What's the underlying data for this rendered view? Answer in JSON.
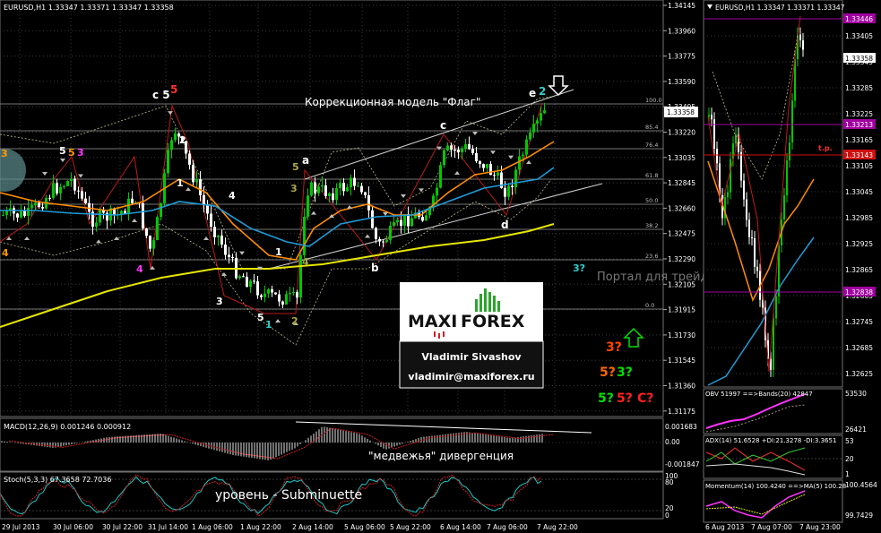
{
  "main_chart": {
    "title": "EURUSD,H1  1.33347 1.33371 1.33347 1.33358",
    "price_ticks": [
      "1.34145",
      "1.33960",
      "1.33775",
      "1.33590",
      "1.33405",
      "1.33220",
      "1.33035",
      "1.32845",
      "1.32660",
      "1.32475",
      "1.32290",
      "1.32105",
      "1.31915",
      "1.31730",
      "1.31545",
      "1.31360",
      "1.31175"
    ],
    "current_price": "1.33358",
    "fib_levels": [
      "100.0",
      "85.4",
      "76.4",
      "61.8",
      "50.0",
      "38.2",
      "23.6",
      "0.0"
    ],
    "time_ticks": [
      "29 Jul 2013",
      "30 Jul 06:00",
      "30 Jul 22:00",
      "31 Jul 14:00",
      "1 Aug 06:00",
      "1 Aug 22:00",
      "2 Aug 14:00",
      "5 Aug 06:00",
      "5 Aug 22:00",
      "6 Aug 14:00",
      "7 Aug 06:00",
      "7 Aug 22:00"
    ],
    "annotation_title": "Коррекционная модель \"Флаг\"",
    "watermark": "Портал для трейдеров - ForTrader.ru",
    "divergence_label": "\"медвежья\" дивергенция",
    "level_label": "уровень - Subminuette",
    "wave_labels": {
      "c5": "c 5",
      "c5_red": "5",
      "w3": "3",
      "w5": "5",
      "w5b": "5",
      "w3b": "3",
      "w4": "4",
      "w1": "1",
      "w4b": "4",
      "w2": "2",
      "w3c": "3",
      "w5c": "5",
      "w1c": "1",
      "w2c": "2",
      "w4c": "4",
      "w1d": "1",
      "w5d": "5",
      "w3d": "3",
      "a": "a",
      "b": "b",
      "c": "c",
      "d": "d",
      "e": "e",
      "e2": "2"
    },
    "projection": {
      "q3cyan": "3?",
      "q3": "3?",
      "q5": "5?",
      "q3g": "3?",
      "q5g": "5?",
      "q5r": "5?",
      "qc": "C?"
    },
    "logo": {
      "maxi": "MAXI",
      "forex": "FOREX",
      "name": "Vladimir Sivashov",
      "email": "vladimir@maxiforex.ru"
    }
  },
  "macd": {
    "title": "MACD(12,26,9) 0.001246 0.000912",
    "ticks": [
      "0.001683",
      "0.00",
      "-0.001847"
    ]
  },
  "stoch": {
    "title": "Stoch(5,3,3) 67.3658 72.7036",
    "ticks": [
      "100",
      "80",
      "20",
      "0"
    ]
  },
  "right_chart": {
    "title": "EURUSD,H1  1.33347 1.33371 1.33347",
    "price_ticks": [
      "1.33405",
      "1.33345",
      "1.33285",
      "1.33225",
      "1.33165",
      "1.33105",
      "1.33045",
      "1.32985",
      "1.32925",
      "1.32865",
      "1.32805",
      "1.32745",
      "1.32685",
      "1.32625"
    ],
    "highlight_top": "1.33446",
    "highlight_mid": "1.33213",
    "highlight_tp": "1.33143",
    "highlight_low": "1.32838",
    "current": "1.33358",
    "tp_label": "t.p.",
    "time_ticks": [
      "6 Aug 2013",
      "7 Aug 07:00",
      "7 Aug 23:00"
    ]
  },
  "obv": {
    "title": "OBV 51997 ==>Bands(20) 42847",
    "ticks": [
      "53530",
      "26421"
    ]
  },
  "adx": {
    "title": "ADX(14) 51.6528 +DI:21.3278 -DI:3.3651",
    "ticks": [
      "53",
      "20",
      "1"
    ]
  },
  "momentum": {
    "title": "Momentum(14) 100.4240 ==>MA(5) 100.28",
    "ticks": [
      "100.4564",
      "99.7429"
    ]
  },
  "colors": {
    "candle_up": "#00c800",
    "candle_down": "#ffffff",
    "ma_fast": "#ff8c00",
    "ma_mid": "#1e9bd7",
    "ma_slow": "#e6e600",
    "grid": "#3a3a3a"
  }
}
